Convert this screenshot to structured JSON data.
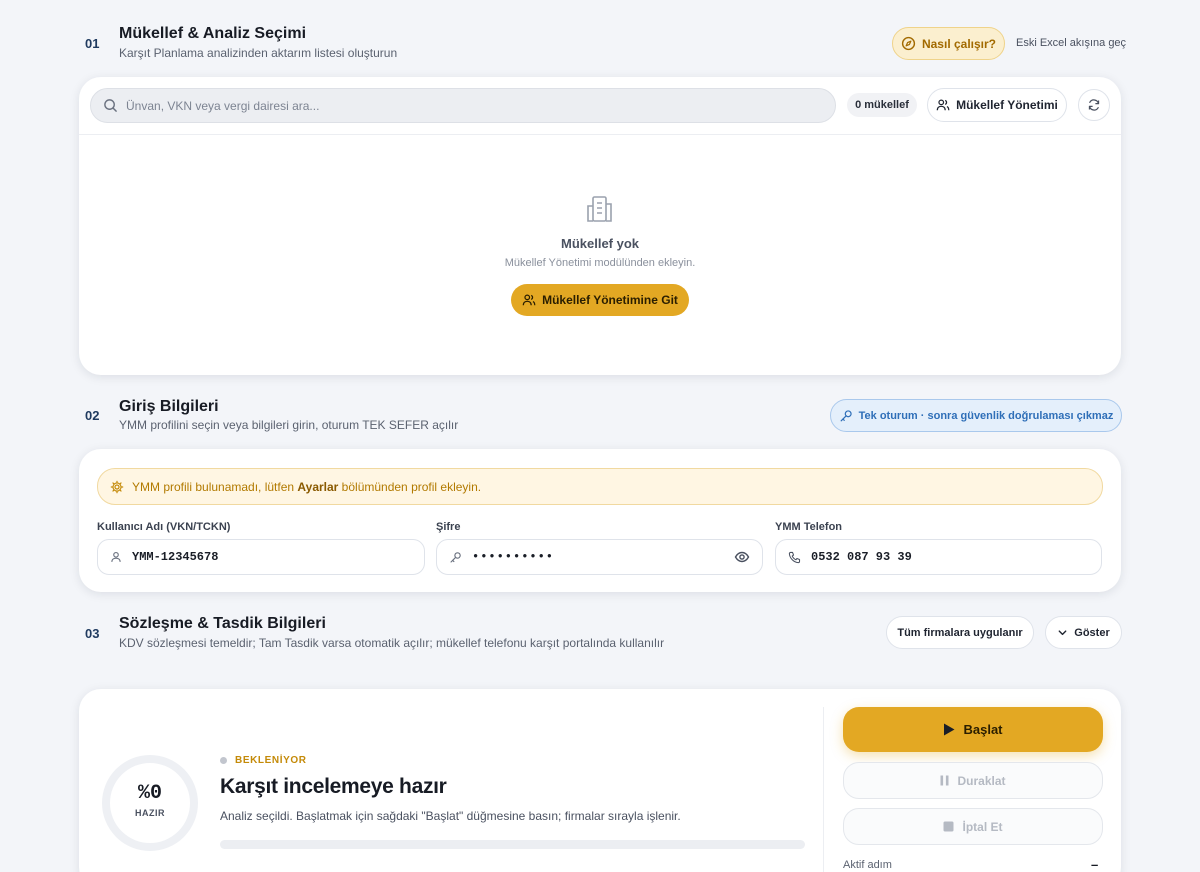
{
  "section1": {
    "num": "01",
    "title": "Mükellef & Analiz Seçimi",
    "subtitle": "Karşıt Planlama analizinden aktarım listesi oluşturun",
    "how_label": "Nasıl çalışır?",
    "excel_link": "Eski Excel akışına geç",
    "search_placeholder": "Ünvan, VKN veya vergi dairesi ara...",
    "count_badge": "0 mükellef",
    "manage_label": "Mükellef Yönetimi",
    "empty_title": "Mükellef yok",
    "empty_sub": "Mükellef Yönetimi modülünden ekleyin.",
    "empty_button": "Mükellef Yönetimine Git"
  },
  "section2": {
    "num": "02",
    "title": "Giriş Bilgileri",
    "subtitle": "YMM profilini seçin veya bilgileri girin, oturum TEK SEFER açılır",
    "info_badge": "Tek oturum · sonra güvenlik doğrulaması çıkmaz",
    "warning_pre": "YMM profili bulunamadı, lütfen ",
    "warning_bold": "Ayarlar",
    "warning_post": " bölümünden profil ekleyin.",
    "user_label": "Kullanıcı Adı (VKN/TCKN)",
    "user_value": "YMM-12345678",
    "pass_label": "Şifre",
    "pass_value": "••••••••••",
    "phone_label": "YMM Telefon",
    "phone_value": "0532 087 93 39"
  },
  "section3": {
    "num": "03",
    "title": "Sözleşme & Tasdik Bilgileri",
    "subtitle": "KDV sözleşmesi temeldir; Tam Tasdik varsa otomatik açılır; mükellef telefonu karşıt portalında kullanılır",
    "apply_all": "Tüm firmalara uygulanır",
    "show": "Göster"
  },
  "status": {
    "percent_text": "%0",
    "ring_label": "HAZIR",
    "progress": 0,
    "state": "BEKLENİYOR",
    "title": "Karşıt incelemeye hazır",
    "description": "Analiz seçildi. Başlatmak için sağdaki \"Başlat\" düğmesine basın; firmalar sırayla işlenir.",
    "start": "Başlat",
    "pause": "Duraklat",
    "cancel": "İptal Et",
    "active_step_label": "Aktif adım",
    "active_step_value": "–"
  },
  "colors": {
    "accent": "#e3a823",
    "accent_dark": "#8a5a00",
    "info_blue": "#2f6fb8",
    "warning_bg": "#fff6e3"
  }
}
